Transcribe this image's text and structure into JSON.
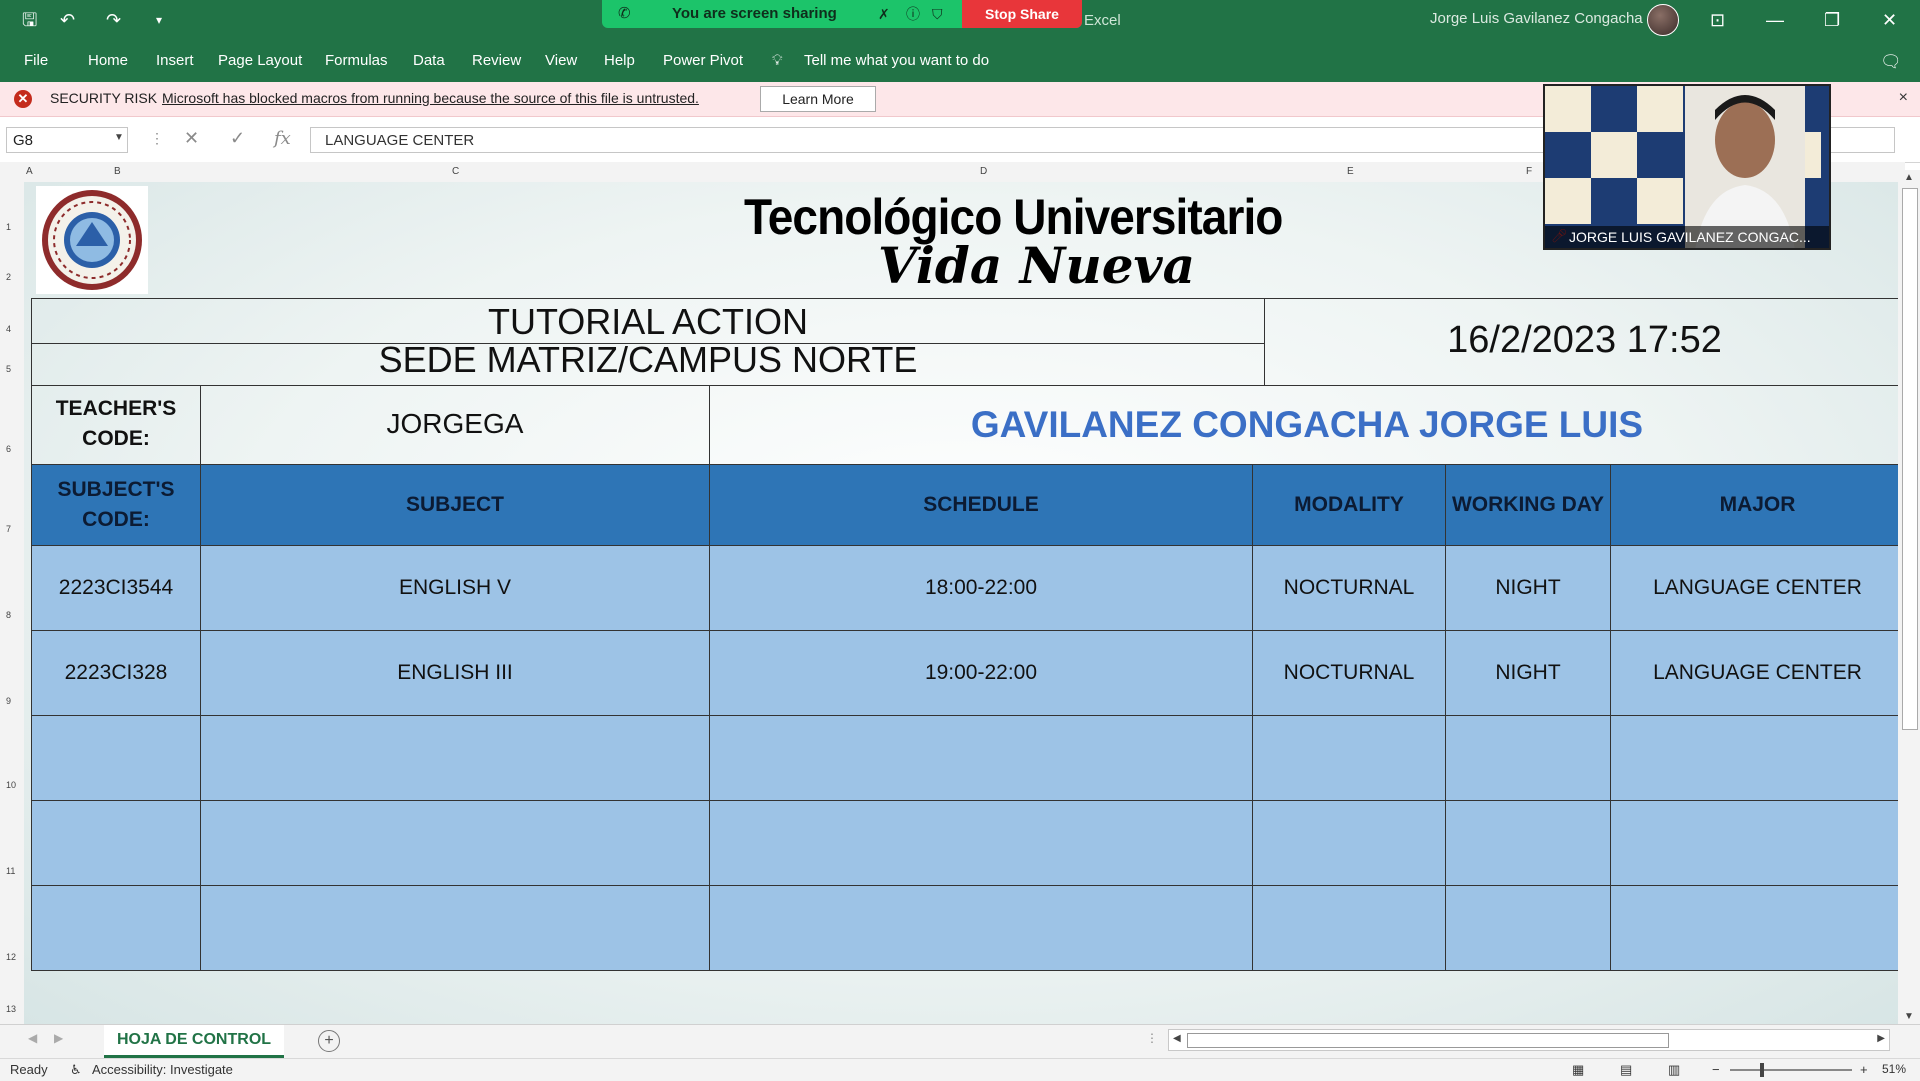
{
  "titlebar": {
    "sharing_text": "You are screen sharing",
    "stop_share": "Stop Share",
    "app_name": "Excel",
    "user_name": "Jorge Luis Gavilanez Congacha"
  },
  "ribbon": {
    "tabs": [
      "File",
      "Home",
      "Insert",
      "Page Layout",
      "Formulas",
      "Data",
      "Review",
      "View",
      "Help",
      "Power Pivot"
    ],
    "tell_me": "Tell me what you want to do"
  },
  "security": {
    "label": "SECURITY RISK",
    "message": "Microsoft has blocked macros from running because the source of this file is untrusted.",
    "learn_more": "Learn More",
    "close": "×"
  },
  "formula_bar": {
    "name_box": "G8",
    "formula": "LANGUAGE CENTER",
    "fx": "fx"
  },
  "columns": [
    "A",
    "B",
    "C",
    "D",
    "E",
    "F"
  ],
  "rows": [
    "1",
    "2",
    "4",
    "5",
    "6",
    "7",
    "8",
    "9",
    "10",
    "11",
    "12",
    "13"
  ],
  "sheet": {
    "title_1": "Tecnológico Universitario",
    "title_2": "Vida Nueva",
    "tutorial_line_1": "TUTORIAL ACTION",
    "tutorial_line_2": "SEDE MATRIZ/CAMPUS NORTE",
    "datetime": "16/2/2023 17:52",
    "teacher_code_label": "TEACHER'S CODE:",
    "teacher_code": "JORGEGA",
    "teacher_name": "GAVILANEZ CONGACHA JORGE LUIS"
  },
  "table": {
    "headers": [
      "SUBJECT'S CODE:",
      "SUBJECT",
      "SCHEDULE",
      "MODALITY",
      "WORKING DAY",
      "MAJOR"
    ],
    "rows": [
      [
        "2223CI3544",
        "ENGLISH V",
        "18:00-22:00",
        "NOCTURNAL",
        "NIGHT",
        "LANGUAGE CENTER"
      ],
      [
        "2223CI328",
        "ENGLISH III",
        "19:00-22:00",
        "NOCTURNAL",
        "NIGHT",
        "LANGUAGE CENTER"
      ],
      [
        "",
        "",
        "",
        "",
        "",
        ""
      ],
      [
        "",
        "",
        "",
        "",
        "",
        ""
      ],
      [
        "",
        "",
        "",
        "",
        "",
        ""
      ]
    ]
  },
  "video": {
    "participant": "JORGE LUIS GAVILANEZ CONGAC..."
  },
  "sheet_tabs": {
    "active": "HOJA DE CONTROL"
  },
  "statusbar": {
    "ready": "Ready",
    "accessibility": "Accessibility: Investigate",
    "zoom": "51%"
  },
  "colors": {
    "excel_green": "#217346",
    "header_blue": "#2e75b6",
    "body_blue": "#9dc3e6",
    "name_blue": "#3b6fc6",
    "security_bg": "#fde7e9"
  }
}
